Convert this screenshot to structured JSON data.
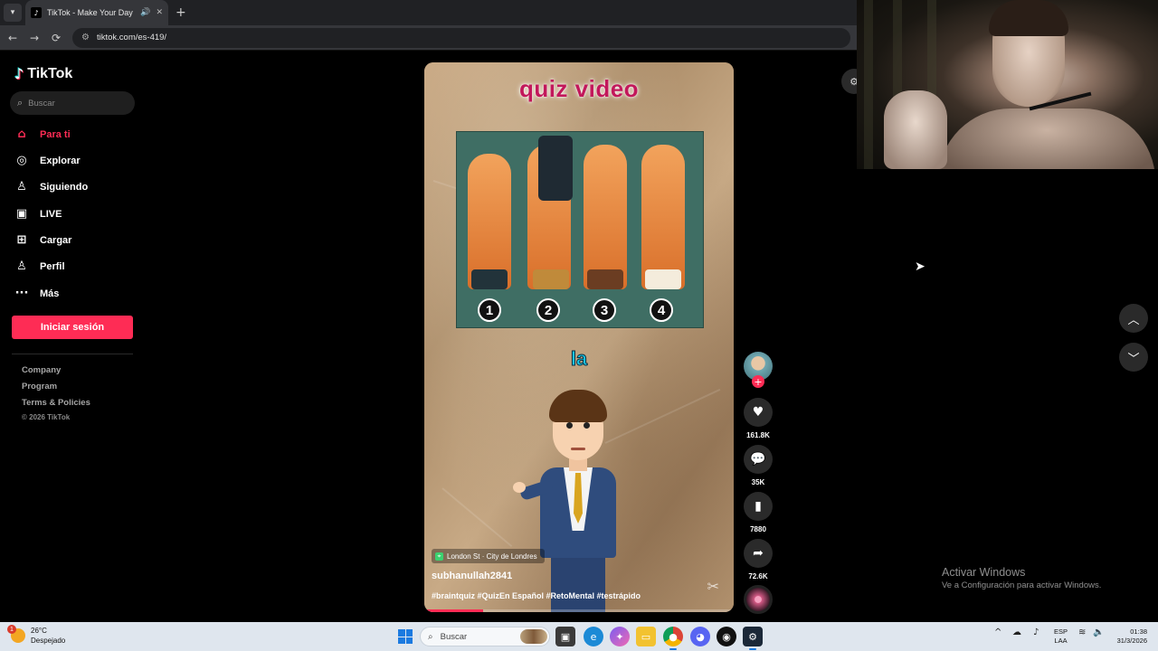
{
  "browser": {
    "tab_title": "TikTok - Make Your Day",
    "tab_favicon": "tiktok-icon",
    "url": "tiktok.com/es-419/"
  },
  "sidebar": {
    "logo_text": "TikTok",
    "search_placeholder": "Buscar",
    "nav": [
      {
        "label": "Para ti",
        "icon": "home-icon",
        "active": true
      },
      {
        "label": "Explorar",
        "icon": "compass-icon"
      },
      {
        "label": "Siguiendo",
        "icon": "following-icon"
      },
      {
        "label": "LIVE",
        "icon": "live-icon"
      },
      {
        "label": "Cargar",
        "icon": "upload-icon"
      },
      {
        "label": "Perfil",
        "icon": "profile-icon"
      },
      {
        "label": "Más",
        "icon": "more-icon"
      }
    ],
    "login_label": "Iniciar sesión",
    "footer": [
      "Company",
      "Program",
      "Terms & Policies"
    ],
    "copyright": "© 2026 TikTok"
  },
  "video": {
    "title_overlay": "quiz video",
    "options": [
      "1",
      "2",
      "3",
      "4"
    ],
    "caption_word": "la",
    "location": "London St · City de Londres",
    "author": "subhanullah2841",
    "hashtags": "#braintquiz #QuizEn Español #RetoMental #testrápido",
    "progress": 0.19
  },
  "actions": {
    "likes": "161.8K",
    "comments": "35K",
    "saves": "7880",
    "shares": "72.6K"
  },
  "overlay": {
    "activate_title": "Activar Windows",
    "activate_sub": "Ve a Configuración para activar Windows."
  },
  "taskbar": {
    "temperature": "26°C",
    "weather": "Despejado",
    "weather_badge": "1",
    "search_placeholder": "Buscar",
    "lang_top": "ESP",
    "lang_bottom": "LAA",
    "time": "01:38",
    "date": "31/3/2026"
  },
  "colors": {
    "accent": "#fe2c55",
    "title_pink": "#c2185b",
    "caption_cyan": "#19c7e6"
  }
}
